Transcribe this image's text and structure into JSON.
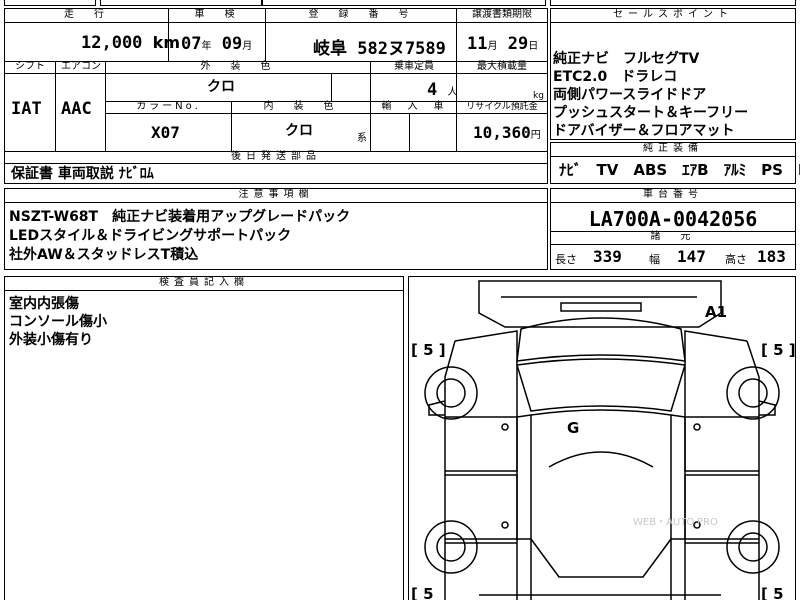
{
  "header_labels": {
    "mileage": "走　行",
    "inspection": "車　検",
    "registration": "登　録　番　号",
    "deadline": "譲渡書類期限",
    "shift": "シフト",
    "aircon": "エアコン",
    "exterior_color": "外　装　色",
    "capacity": "乗車定員",
    "max_load": "最大積載量",
    "color_no": "カラーNo.",
    "interior_color": "内　装　色",
    "import": "輸　入　車",
    "recycle": "リサイクル預託金",
    "later_parts": "後日発送部品",
    "notes": "注意事項欄",
    "inspector": "検査員記入欄",
    "sales_points": "セールスポイント",
    "equipment": "純正装備",
    "chassis": "車台番号",
    "specs": "諸　元"
  },
  "vehicle": {
    "mileage_value": "12,000",
    "mileage_unit": "km",
    "inspection_year": "07",
    "inspection_year_unit": "年",
    "inspection_month": "09",
    "inspection_month_unit": "月",
    "registration_number": "岐阜 582ヌ7589",
    "deadline_month": "11",
    "deadline_month_unit": "月",
    "deadline_day": "29",
    "deadline_day_unit": "日",
    "shift": "IAT",
    "aircon": "AAC",
    "exterior_color": "クロ",
    "capacity": "4",
    "capacity_unit": "人",
    "max_load_unit": "kg",
    "color_no": "X07",
    "interior_color": "クロ",
    "interior_color_suffix": "系",
    "recycle_fee": "10,360",
    "recycle_unit": "円"
  },
  "later_parts_text": "保証書 車両取説 ﾅﾋﾞﾛﾑ",
  "notes_lines": [
    "NSZT-W68T　純正ナビ装着用アップグレードパック",
    "LEDスタイル＆ドライビングサポートパック",
    "社外AW＆スタッドレスT積込"
  ],
  "inspector_lines": [
    "室内内張傷",
    "コンソール傷小",
    "外装小傷有り"
  ],
  "sales_points_lines": [
    "純正ナビ　フルセグTV",
    "ETC2.0　ドラレコ",
    "両側パワースライドドア",
    "プッシュスタート＆キーフリー",
    "ドアバイザー＆フロアマット"
  ],
  "equipment_line": "ﾅﾋﾞ　TV　ABS　ｴｱB　ｱﾙﾐ　PS　PW",
  "chassis_number": "LA700A-0042056",
  "specs": {
    "length_label": "長さ",
    "length_value": "339",
    "width_label": "幅",
    "width_value": "147",
    "height_label": "高さ",
    "height_value": "183"
  },
  "diagram_marks": {
    "a1": "A1",
    "g": "G",
    "tire_fl": "[ 5 ]",
    "tire_fr": "[ 5 ]",
    "tire_rl": "[ 5",
    "tire_rr": "[ 5",
    "watermark": "WEB・AUTO.PRO"
  }
}
